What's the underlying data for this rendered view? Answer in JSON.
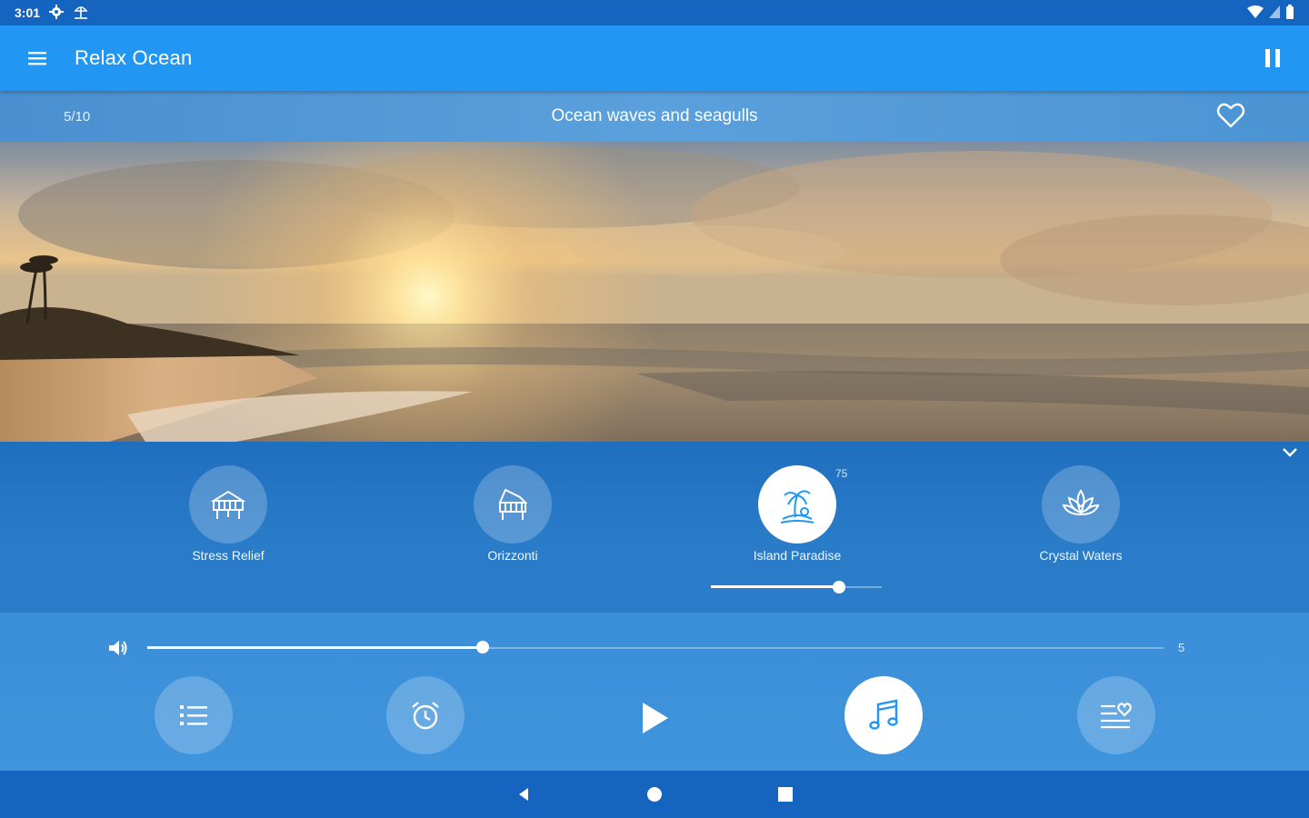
{
  "status_bar": {
    "time": "3:01"
  },
  "app_bar": {
    "title": "Relax Ocean"
  },
  "track": {
    "counter": "5/10",
    "title": "Ocean waves and seagulls"
  },
  "mixer": {
    "sounds": [
      {
        "label": "Stress Relief",
        "icon": "piano-icon",
        "active": false
      },
      {
        "label": "Orizzonti",
        "icon": "grand-piano-icon",
        "active": false
      },
      {
        "label": "Island Paradise",
        "icon": "palm-island-icon",
        "active": true,
        "level_label": "75",
        "level": 0.75
      },
      {
        "label": "Crystal Waters",
        "icon": "lotus-icon",
        "active": false
      }
    ]
  },
  "volume": {
    "level": 0.33,
    "max_label": "5"
  },
  "controls": {
    "buttons": [
      {
        "name": "playlist-button",
        "icon": "list-icon"
      },
      {
        "name": "timer-button",
        "icon": "alarm-clock-icon"
      },
      {
        "name": "play-button",
        "icon": "play-icon"
      },
      {
        "name": "music-button",
        "icon": "music-note-icon"
      },
      {
        "name": "favorites-list-button",
        "icon": "heart-list-icon"
      }
    ]
  },
  "colors": {
    "primary": "#2196f3",
    "primary_dark": "#1565c0",
    "accent": "#ffffff"
  }
}
